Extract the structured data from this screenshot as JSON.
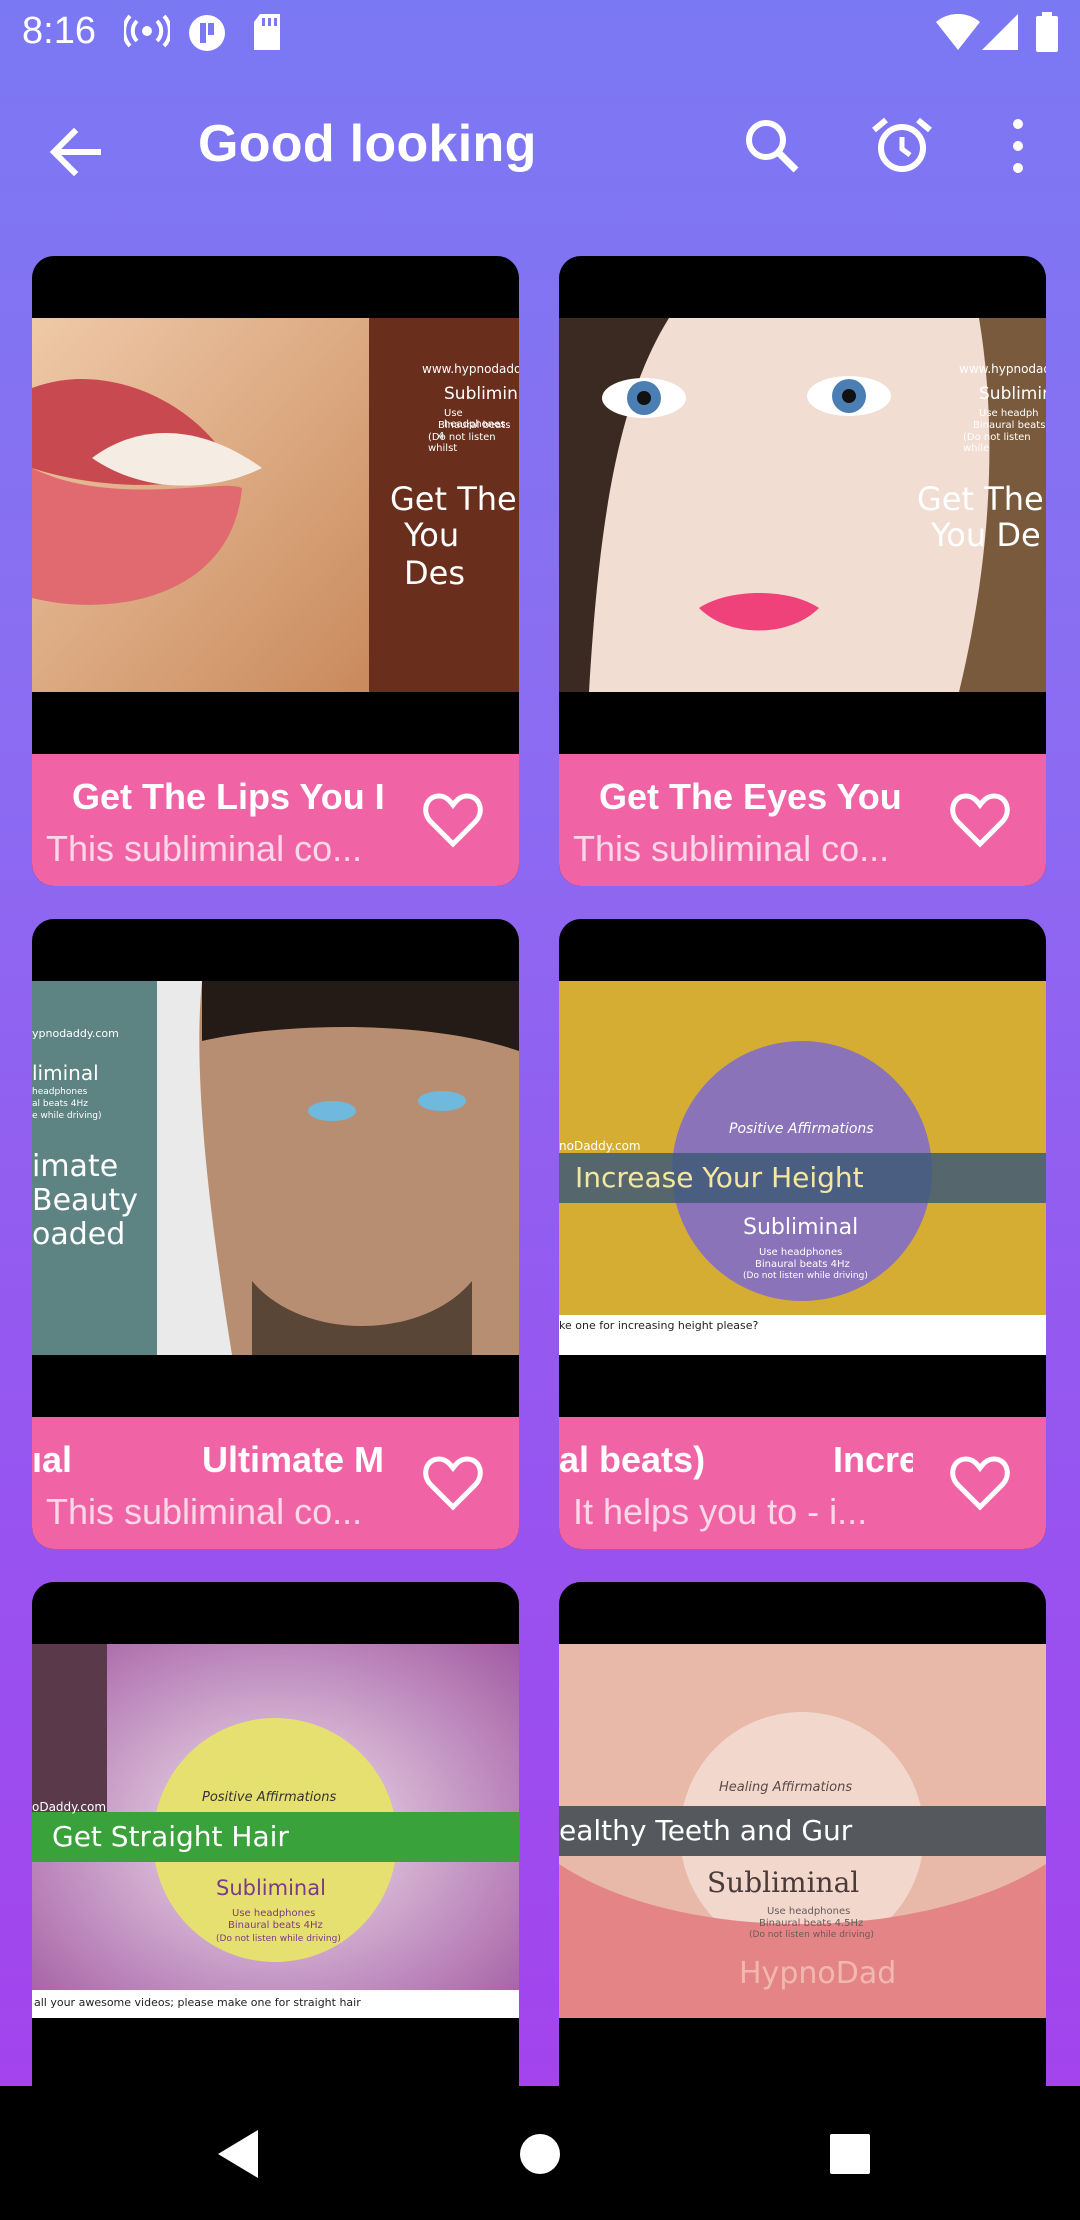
{
  "status_bar": {
    "time": "8:16",
    "icons": [
      "broadcast-icon",
      "app-notification-icon",
      "sd-card-icon",
      "wifi-icon",
      "signal-icon",
      "battery-icon"
    ]
  },
  "app_bar": {
    "title": "Good looking",
    "actions": [
      "search-icon",
      "alarm-icon",
      "more-vert-icon"
    ]
  },
  "cards": [
    {
      "title": "Get The Lips You I",
      "description": "This subliminal co...",
      "thumb_lines": [
        "www.hypnodaddy",
        "Subliminal",
        "Use headphones",
        "Binaural beats 4",
        "(Do not listen whilst",
        "Get The",
        "You Des"
      ]
    },
    {
      "title": "Get The Eyes You",
      "description": "This subliminal co...",
      "thumb_lines": [
        "www.hypnodad",
        "Subliminal",
        "Use headph",
        "Binaural beats",
        "(Do not listen while",
        "Get The",
        "You De"
      ]
    },
    {
      "title_left": "ıal",
      "title": "Ultimate M",
      "description": "This subliminal co...",
      "thumb_lines": [
        "ypnodaddy.com",
        "liminal",
        "headphones",
        "al beats 4Hz",
        "e while driving)",
        "imate",
        "Beauty",
        "oaded"
      ]
    },
    {
      "title_left": "al beats)",
      "title": "Incre",
      "description": "It helps you to  - i...",
      "thumb_lines": [
        "noDaddy.com",
        "Positive Affirmations",
        "Increase Your Height",
        "Subliminal",
        "Use headphones",
        "Binaural beats 4Hz",
        "(Do not listen while driving)",
        "ke one for increasing height please?"
      ]
    },
    {
      "title": "",
      "description": "",
      "thumb_lines": [
        "oDaddy.com",
        "Positive Affirmations",
        "Get Straight Hair",
        "Subliminal",
        "Use headphones",
        "Binaural beats 4Hz",
        "(Do not listen while driving)",
        "all your awesome videos; please make one for straight hair"
      ]
    },
    {
      "title": "",
      "description": "",
      "thumb_lines": [
        "Healing Affirmations",
        "ealthy Teeth and Gur",
        "Subliminal",
        "Use headphones",
        "Binaural beats 4.5Hz",
        "(Do not listen while driving)",
        "HypnoDad"
      ]
    }
  ],
  "colors": {
    "caption": "#f064a6",
    "accent": "#7b78f3"
  },
  "nav": [
    "back-triangle-icon",
    "home-circle-icon",
    "recents-square-icon"
  ]
}
